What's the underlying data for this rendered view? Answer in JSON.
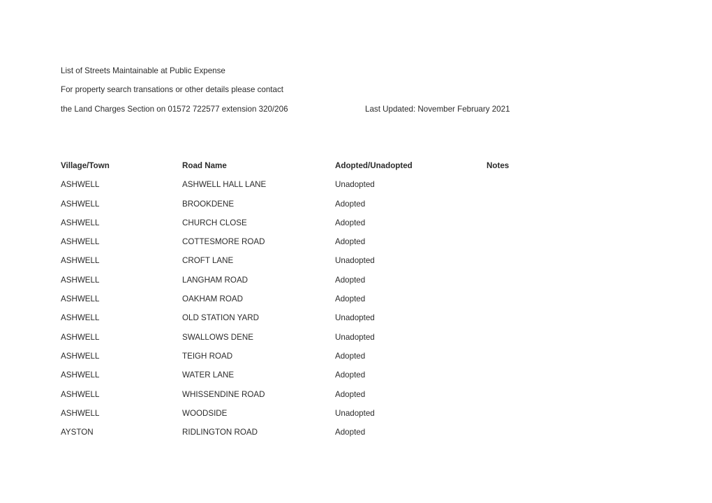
{
  "document": {
    "intro_lines": [
      "List of Streets Maintainable at Public Expense",
      "For property search transations or other details please contact",
      "the Land Charges Section on 01572 722577 extension 320/206"
    ],
    "last_updated": "Last Updated: November February 2021",
    "text_color": "#2b2b2b",
    "background_color": "#ffffff"
  },
  "table": {
    "headers": {
      "village": "Village/Town",
      "road": "Road Name",
      "status": "Adopted/Unadopted",
      "notes": "Notes"
    },
    "rows": [
      {
        "village": "ASHWELL",
        "road": "ASHWELL HALL LANE",
        "status": "Unadopted",
        "notes": ""
      },
      {
        "village": "ASHWELL",
        "road": "BROOKDENE",
        "status": "Adopted",
        "notes": ""
      },
      {
        "village": "ASHWELL",
        "road": "CHURCH CLOSE",
        "status": "Adopted",
        "notes": ""
      },
      {
        "village": "ASHWELL",
        "road": "COTTESMORE ROAD",
        "status": "Adopted",
        "notes": ""
      },
      {
        "village": "ASHWELL",
        "road": "CROFT LANE",
        "status": "Unadopted",
        "notes": ""
      },
      {
        "village": "ASHWELL",
        "road": "LANGHAM ROAD",
        "status": "Adopted",
        "notes": ""
      },
      {
        "village": "ASHWELL",
        "road": "OAKHAM ROAD",
        "status": "Adopted",
        "notes": ""
      },
      {
        "village": "ASHWELL",
        "road": "OLD STATION YARD",
        "status": "Unadopted",
        "notes": ""
      },
      {
        "village": "ASHWELL",
        "road": "SWALLOWS DENE",
        "status": "Unadopted",
        "notes": ""
      },
      {
        "village": "ASHWELL",
        "road": "TEIGH ROAD",
        "status": "Adopted",
        "notes": ""
      },
      {
        "village": "ASHWELL",
        "road": "WATER LANE",
        "status": "Adopted",
        "notes": ""
      },
      {
        "village": "ASHWELL",
        "road": "WHISSENDINE ROAD",
        "status": "Adopted",
        "notes": ""
      },
      {
        "village": "ASHWELL",
        "road": "WOODSIDE",
        "status": "Unadopted",
        "notes": ""
      },
      {
        "village": "AYSTON",
        "road": "RIDLINGTON ROAD",
        "status": "Adopted",
        "notes": ""
      }
    ]
  }
}
